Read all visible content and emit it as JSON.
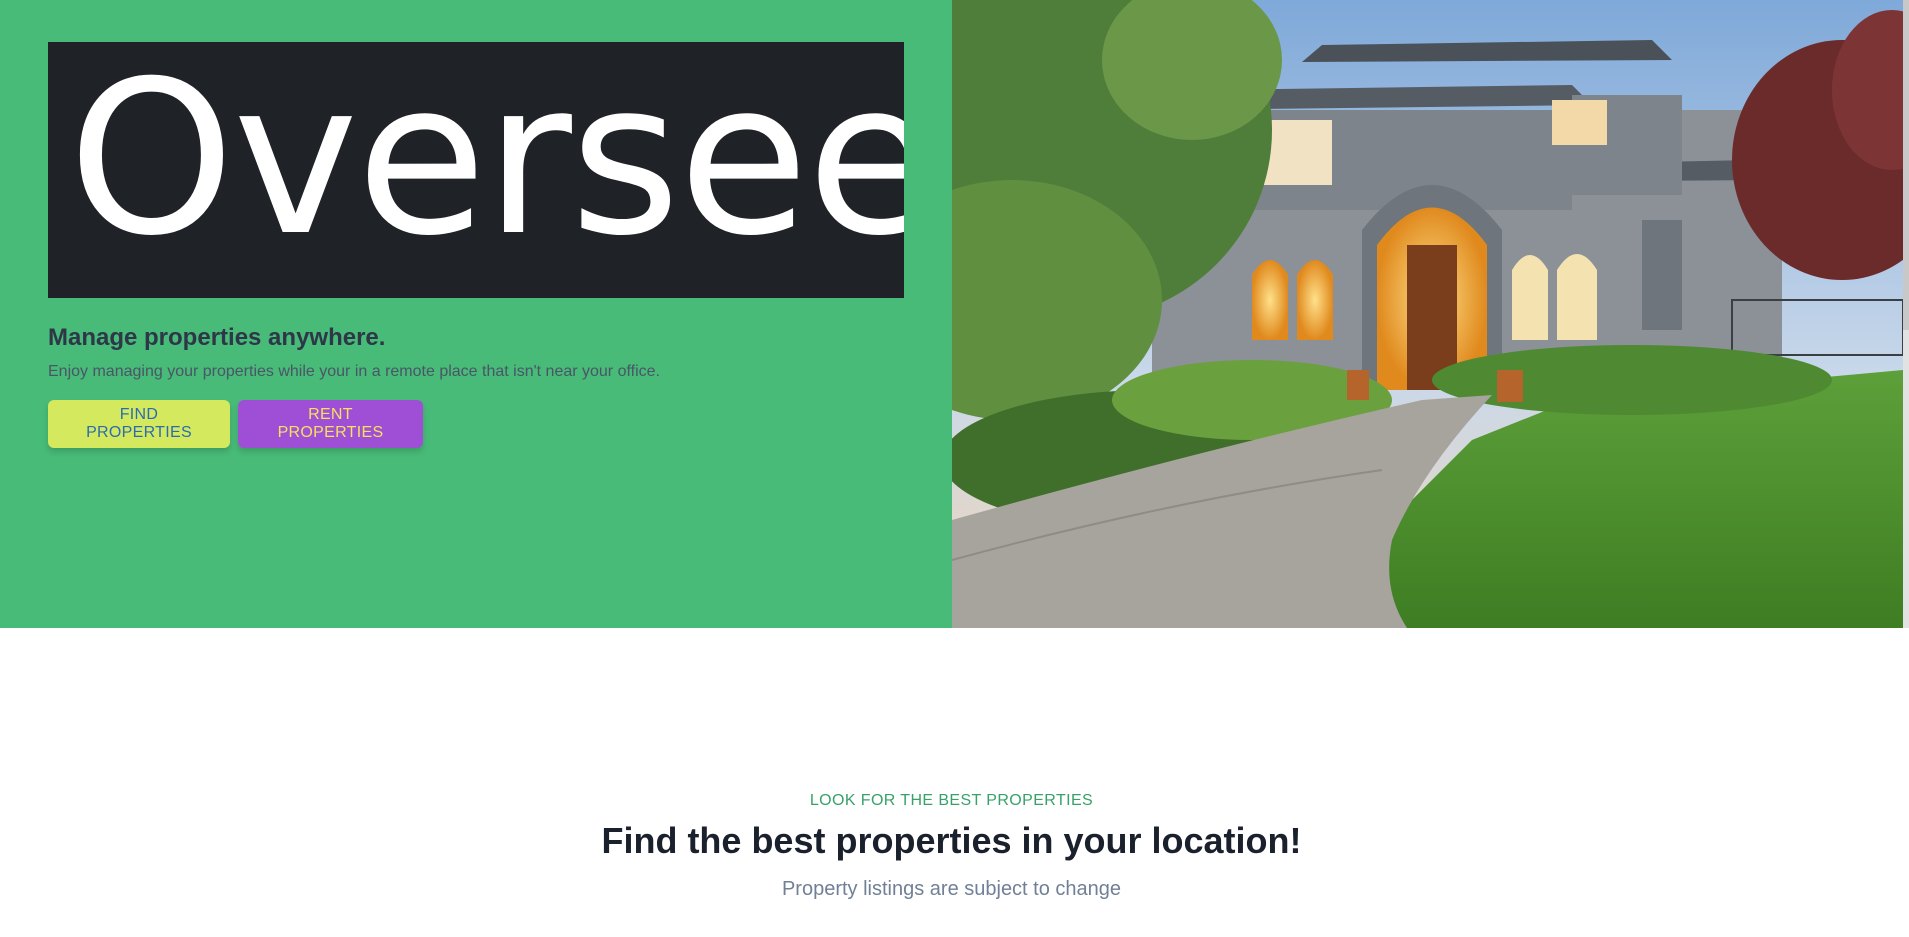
{
  "brand": {
    "logo_text": "Overseer"
  },
  "hero": {
    "headline": "Manage properties anywhere.",
    "subline": "Enjoy managing your properties while your in a remote place that isn't near your office.",
    "find_button": "FIND PROPERTIES",
    "rent_button": "RENT PROPERTIES"
  },
  "listing_section": {
    "eyebrow": "LOOK FOR THE BEST PROPERTIES",
    "title": "Find the best properties in your location!",
    "subtitle": "Property listings are subject to change"
  },
  "colors": {
    "hero_bg": "#48bb78",
    "logo_bg": "#1f2328",
    "find_button_bg": "#d4e95e",
    "rent_button_bg": "#9f4fd6",
    "eyebrow": "#38a169"
  }
}
